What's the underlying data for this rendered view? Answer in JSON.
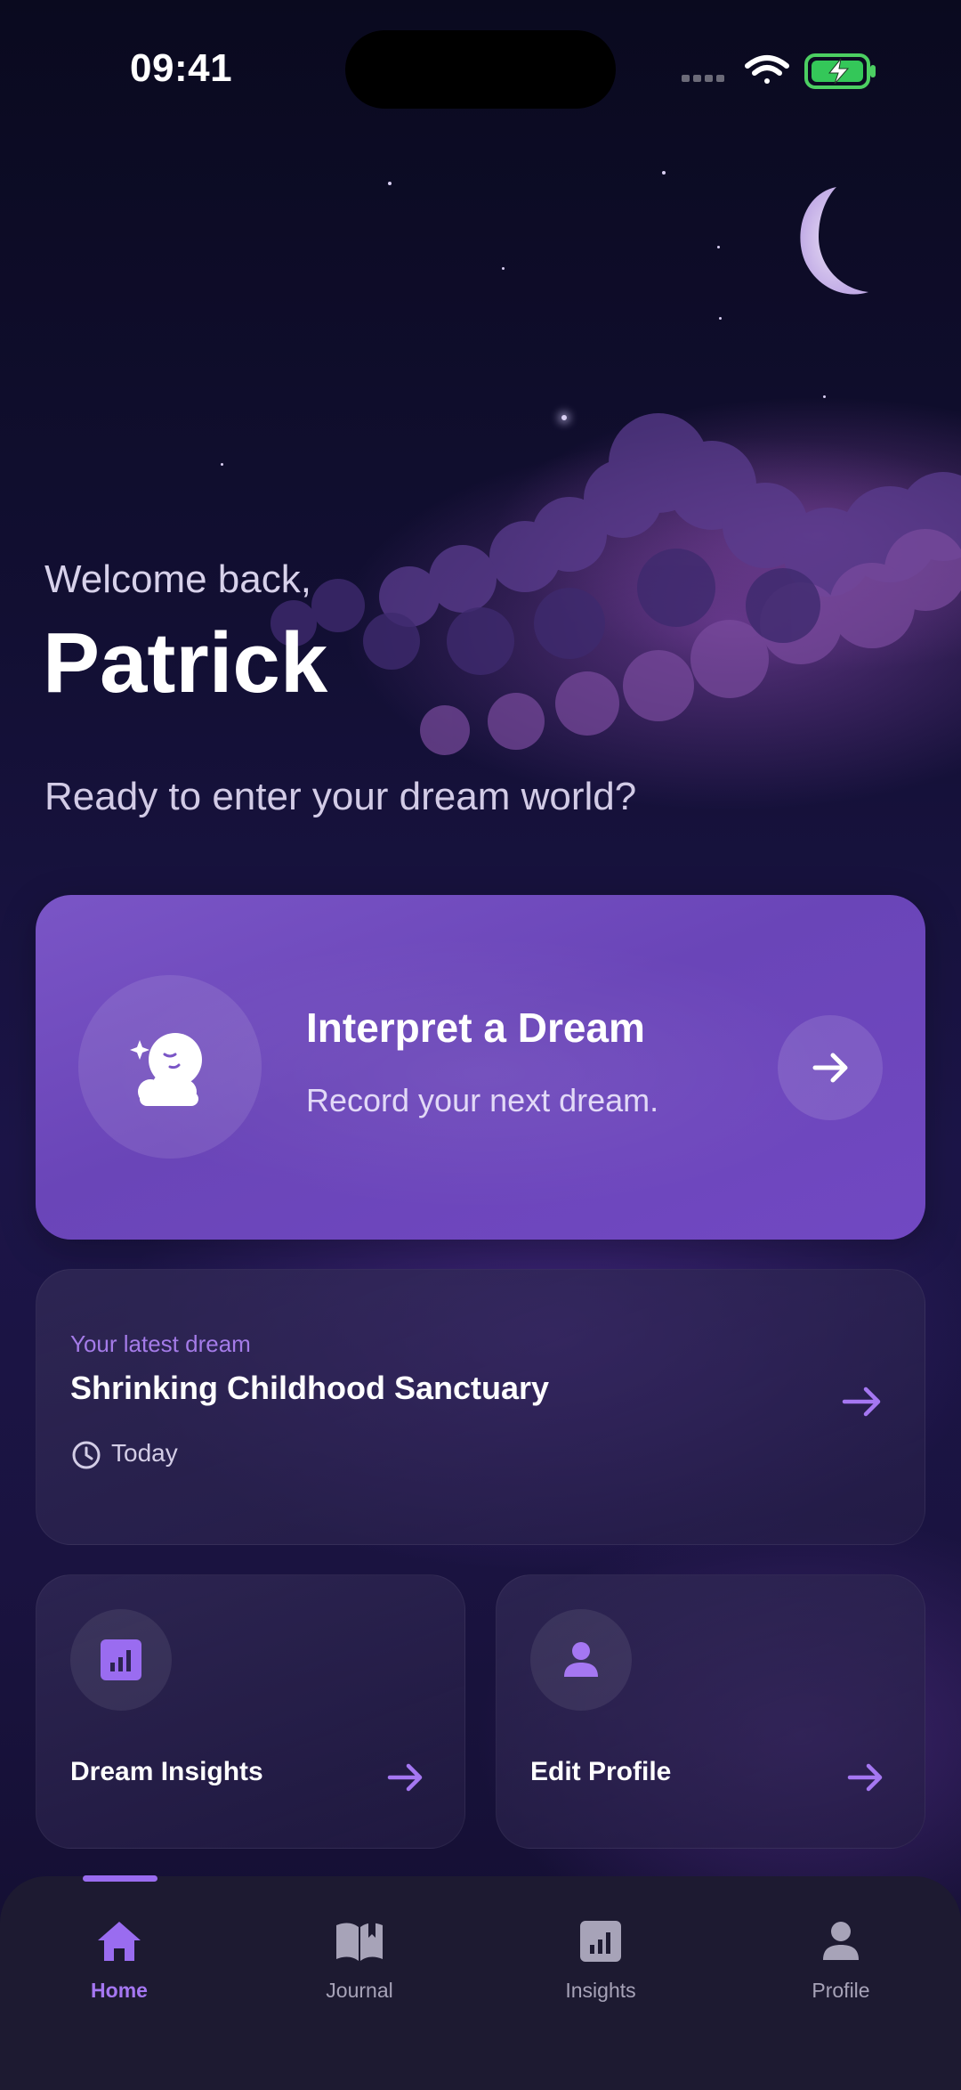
{
  "status_bar": {
    "time": "09:41"
  },
  "greeting": {
    "welcome": "Welcome back,",
    "name": "Patrick",
    "subtitle": "Ready to enter your dream world?"
  },
  "interpret_card": {
    "title": "Interpret a Dream",
    "subtitle": "Record your next dream.",
    "icon": "sleeping-moon-cloud-icon",
    "action_icon": "arrow-right-icon"
  },
  "latest_dream": {
    "label": "Your latest dream",
    "title": "Shrinking Childhood Sanctuary",
    "date": "Today",
    "icon": "clock-icon"
  },
  "quick_actions": [
    {
      "label": "Dream Insights",
      "icon": "bar-chart-icon"
    },
    {
      "label": "Edit Profile",
      "icon": "person-icon"
    }
  ],
  "bottom_nav": {
    "items": [
      {
        "label": "Home",
        "icon": "home-icon",
        "active": true
      },
      {
        "label": "Journal",
        "icon": "book-icon",
        "active": false
      },
      {
        "label": "Insights",
        "icon": "bar-chart-icon",
        "active": false
      },
      {
        "label": "Profile",
        "icon": "person-icon",
        "active": false
      }
    ]
  },
  "colors": {
    "accent": "#9a6cf0",
    "card_purple": "#6f4bbf",
    "background": "#120f33",
    "nav_background": "#1d1a31"
  }
}
